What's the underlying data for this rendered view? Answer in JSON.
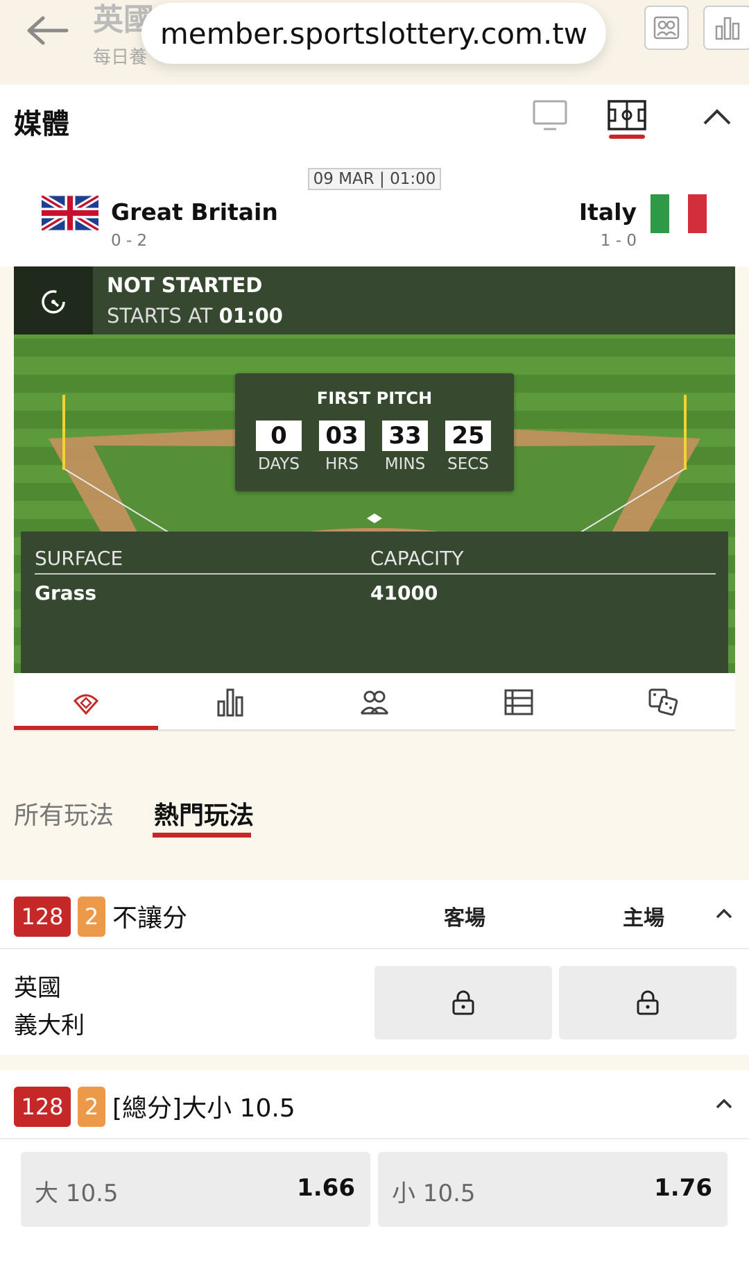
{
  "header": {
    "title": "英國",
    "subtitle": "每日養",
    "url": "member.sportslottery.com.tw"
  },
  "media": {
    "title": "媒體"
  },
  "match": {
    "date": "09 MAR | 01:00",
    "home": {
      "name": "Great Britain",
      "record": "0 - 2"
    },
    "away": {
      "name": "Italy",
      "record": "1 - 0"
    }
  },
  "status": {
    "title": "NOT STARTED",
    "starts_label": "STARTS AT",
    "starts_time": "01:00"
  },
  "countdown": {
    "title": "FIRST PITCH",
    "units": [
      {
        "value": "0",
        "label": "DAYS"
      },
      {
        "value": "03",
        "label": "HRS"
      },
      {
        "value": "33",
        "label": "MINS"
      },
      {
        "value": "25",
        "label": "SECS"
      }
    ]
  },
  "venue": {
    "surface_label": "SURFACE",
    "surface_value": "Grass",
    "capacity_label": "CAPACITY",
    "capacity_value": "41000"
  },
  "icon_tabs": [
    "field-icon",
    "stats-icon",
    "lineup-icon",
    "table-icon",
    "dice-icon"
  ],
  "market_tabs": {
    "all": "所有玩法",
    "popular": "熱門玩法"
  },
  "markets": [
    {
      "number": "128",
      "count": "2",
      "name": "不讓分",
      "col_away": "客場",
      "col_home": "主場",
      "teams": [
        "英國",
        "義大利"
      ]
    },
    {
      "number": "128",
      "count": "2",
      "name": "[總分]大小 10.5",
      "options": [
        {
          "label": "大 10.5",
          "odds": "1.66"
        },
        {
          "label": "小 10.5",
          "odds": "1.76"
        }
      ]
    }
  ],
  "colors": {
    "accent": "#c62828",
    "badge_orange": "#ec9a4a",
    "panel_green": "#36482f"
  }
}
